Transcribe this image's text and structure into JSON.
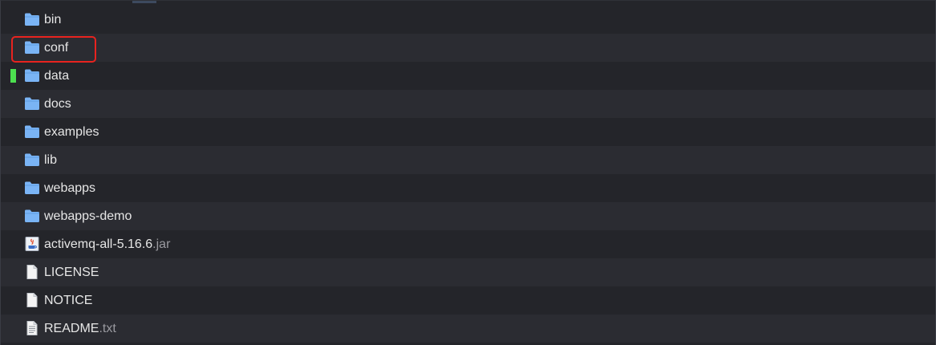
{
  "files": [
    {
      "name": "bin",
      "ext": "",
      "icon": "folder-icon"
    },
    {
      "name": "conf",
      "ext": "",
      "icon": "folder-icon"
    },
    {
      "name": "data",
      "ext": "",
      "icon": "folder-icon"
    },
    {
      "name": "docs",
      "ext": "",
      "icon": "folder-icon"
    },
    {
      "name": "examples",
      "ext": "",
      "icon": "folder-icon"
    },
    {
      "name": "lib",
      "ext": "",
      "icon": "folder-icon"
    },
    {
      "name": "webapps",
      "ext": "",
      "icon": "folder-icon"
    },
    {
      "name": "webapps-demo",
      "ext": "",
      "icon": "folder-icon"
    },
    {
      "name": "activemq-all-5.16.6",
      "ext": ".jar",
      "icon": "java-jar-icon"
    },
    {
      "name": "LICENSE",
      "ext": "",
      "icon": "blank-file-icon"
    },
    {
      "name": "NOTICE",
      "ext": "",
      "icon": "blank-file-icon"
    },
    {
      "name": "README",
      "ext": ".txt",
      "icon": "text-file-icon"
    }
  ],
  "highlighted_item": "conf",
  "status_marked_item": "data",
  "colors": {
    "background": "#24252a",
    "row_alt": "#2b2c32",
    "text": "#e6e6e6",
    "extension_text": "#9a9aa0",
    "folder": "#7ab4f5",
    "highlight_border": "#e8231f",
    "status_mark": "#4cdf4f"
  }
}
